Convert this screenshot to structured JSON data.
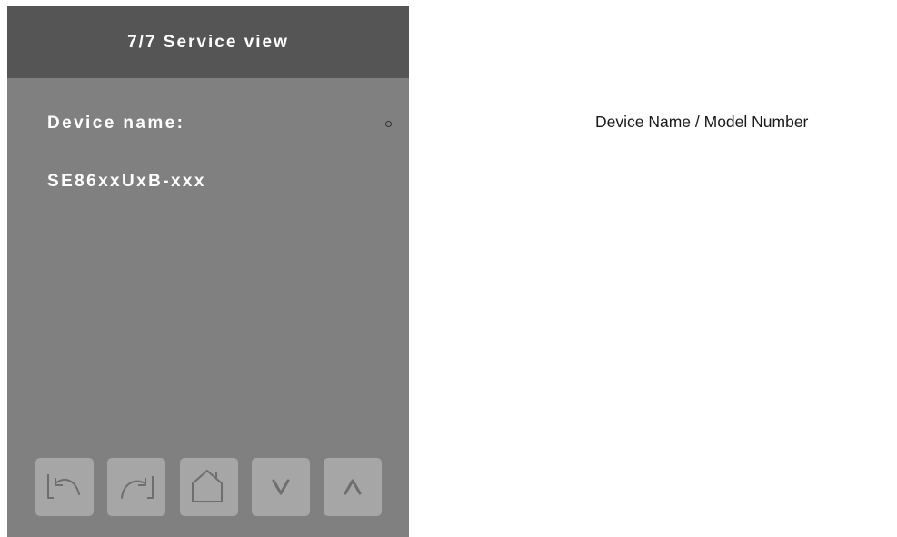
{
  "screen": {
    "header_title": "7/7 Service view",
    "field_label": "Device name:",
    "field_value": "SE86xxUxB-xxx"
  },
  "buttons": [
    {
      "icon": "undo-back-icon"
    },
    {
      "icon": "redo-forward-icon"
    },
    {
      "icon": "home-icon"
    },
    {
      "icon": "chevron-down-icon"
    },
    {
      "icon": "chevron-up-icon"
    }
  ],
  "callout": {
    "text": "Device Name / Model Number"
  },
  "colors": {
    "screen_bg": "#808080",
    "header_bg": "#555555",
    "button_bg": "#a6a6a6",
    "icon_stroke": "#6e6e6e",
    "text": "#ffffff"
  }
}
